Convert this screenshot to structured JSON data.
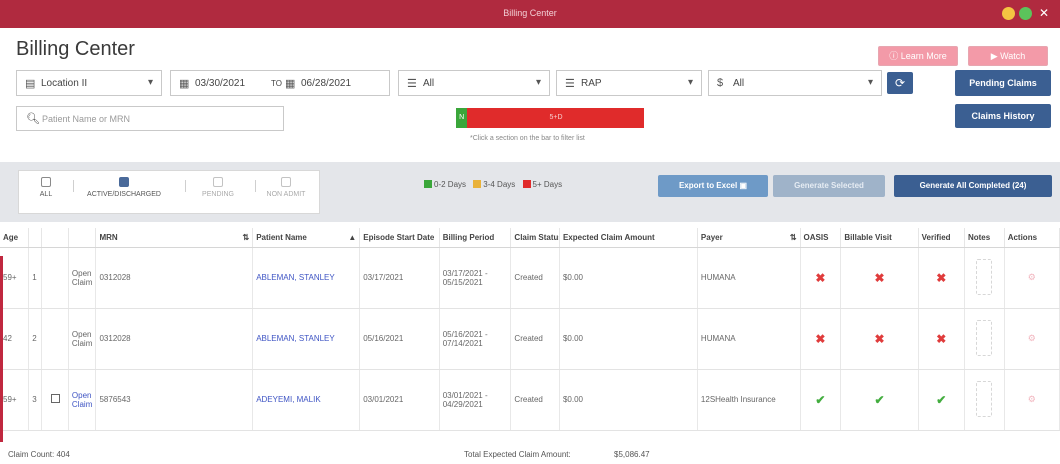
{
  "window": {
    "title": "Billing Center"
  },
  "page": {
    "title": "Billing Center"
  },
  "header_buttons": {
    "learn_more": "Learn More",
    "watch": "Watch",
    "pending_claims": "Pending Claims",
    "claims_history": "Claims History"
  },
  "filters": {
    "location": "Location II",
    "date_from": "03/30/2021",
    "to_label": "TO",
    "date_to": "06/28/2021",
    "filter_a": "All",
    "filter_type": "RAP",
    "filter_payer": "All",
    "search_placeholder": "Patient Name or MRN"
  },
  "age_bar": {
    "green_label": "N",
    "red_label": "5+D",
    "hint": "*Click a section on the bar to filter list",
    "green_fraction": 0.06
  },
  "status_filters": [
    {
      "label": "ALL",
      "checked": false,
      "dim": false
    },
    {
      "label": "ACTIVE/DISCHARGED",
      "checked": true,
      "dim": false
    },
    {
      "label": "PENDING",
      "checked": false,
      "dim": true
    },
    {
      "label": "NON ADMIT",
      "checked": false,
      "dim": true
    }
  ],
  "legend": [
    {
      "label": "0-2 Days",
      "color": "#3aa63a"
    },
    {
      "label": "3-4 Days",
      "color": "#e9b23a"
    },
    {
      "label": "5+ Days",
      "color": "#e02b2b"
    }
  ],
  "table_actions": {
    "export": "Export to Excel",
    "generate_selected": "Generate Selected",
    "generate_all": "Generate All Completed (24)"
  },
  "columns": [
    "Age",
    "",
    "",
    "",
    "MRN",
    "Patient Name",
    "Episode Start Date",
    "Billing Period",
    "Claim Status",
    "Expected Claim Amount",
    "Payer",
    "OASIS",
    "Billable Visit",
    "Verified",
    "Notes",
    "Actions"
  ],
  "rows": [
    {
      "age": "59+",
      "num": "1",
      "claim": "Open Claim",
      "claim_link": false,
      "mrn": "0312028",
      "patient": "ABLEMAN, STANLEY",
      "episode_start": "03/17/2021",
      "billing_period": "03/17/2021 - 05/15/2021",
      "status": "Created",
      "amount": "$0.00",
      "payer": "HUMANA",
      "oasis": "✖",
      "billable": "✖",
      "verified": "✖",
      "checkbox": false
    },
    {
      "age": "42",
      "num": "2",
      "claim": "Open Claim",
      "claim_link": false,
      "mrn": "0312028",
      "patient": "ABLEMAN, STANLEY",
      "episode_start": "05/16/2021",
      "billing_period": "05/16/2021 - 07/14/2021",
      "status": "Created",
      "amount": "$0.00",
      "payer": "HUMANA",
      "oasis": "✖",
      "billable": "✖",
      "verified": "✖",
      "checkbox": false
    },
    {
      "age": "59+",
      "num": "3",
      "claim": "Open Claim",
      "claim_link": true,
      "mrn": "5876543",
      "patient": "ADEYEMI, MALIK",
      "episode_start": "03/01/2021",
      "billing_period": "03/01/2021 - 04/29/2021",
      "status": "Created",
      "amount": "$0.00",
      "payer": "12SHealth Insurance",
      "oasis": "✔",
      "billable": "✔",
      "verified": "✔",
      "checkbox": true
    }
  ],
  "footer": {
    "claim_count": "Claim Count: 404",
    "total_label": "Total Expected Claim Amount:",
    "total_value": "$5,086.47"
  }
}
